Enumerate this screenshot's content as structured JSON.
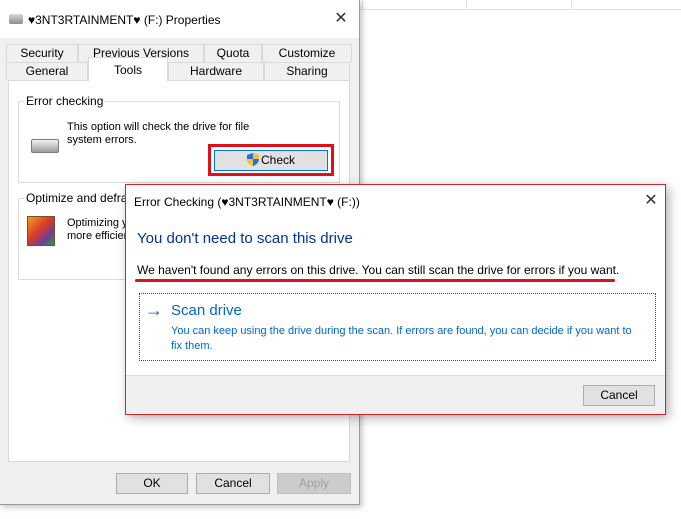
{
  "properties": {
    "title": "♥3NT3RTAINMENT♥ (F:) Properties",
    "close_glyph": "✕",
    "tabs_row1": [
      "Security",
      "Previous Versions",
      "Quota",
      "Customize"
    ],
    "tabs_row2": [
      "General",
      "Tools",
      "Hardware",
      "Sharing"
    ],
    "active_tab": "Tools",
    "error_checking": {
      "label": "Error checking",
      "description_line1": "This option will check the drive for file",
      "description_line2": "system errors.",
      "check_button": "Check",
      "drive_icon": "hard-drive-icon",
      "shield_icon": "uac-shield-icon"
    },
    "optimize": {
      "label": "Optimize and defragn",
      "description_line1": "Optimizing yo",
      "description_line2": "more efficien",
      "icon": "defrag-icon"
    },
    "buttons": {
      "ok": "OK",
      "cancel": "Cancel",
      "apply": "Apply"
    }
  },
  "dialog": {
    "title": "Error Checking (♥3NT3RTAINMENT♥ (F:))",
    "close_glyph": "✕",
    "heading": "You don't need to scan this drive",
    "description": "We haven't found any errors on this drive. You can still scan the drive for errors if you want.",
    "scan_arrow": "→",
    "scan_title": "Scan drive",
    "scan_description": "You can keep using the drive during the scan. If errors are found, you can decide if you want to fix them.",
    "cancel": "Cancel"
  },
  "colors": {
    "highlight_red": "#e0101a",
    "link_blue": "#0066cc",
    "heading_blue": "#003399",
    "default_button_border": "#0078d7"
  }
}
